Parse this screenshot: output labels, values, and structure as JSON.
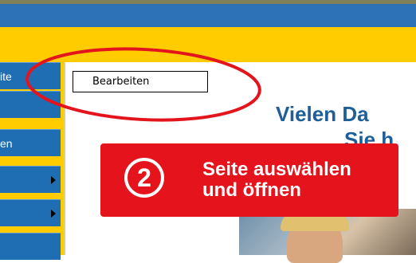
{
  "colors": {
    "topBar": "#2d72b7",
    "yellowBand": "#ffcc00",
    "nav": "#1f6db3",
    "heading": "#1f5f99",
    "callout": "#e5131b",
    "annotation": "#e3141c"
  },
  "sidebar": {
    "items": [
      {
        "label": "ite",
        "has_submenu": false
      },
      {
        "label": "",
        "has_submenu": false
      },
      {
        "label": "en",
        "has_submenu": false
      },
      {
        "label": "",
        "has_submenu": true
      },
      {
        "label": "",
        "has_submenu": true
      },
      {
        "label": "",
        "has_submenu": false
      }
    ]
  },
  "toolbar": {
    "edit_label": "Bearbeiten"
  },
  "main": {
    "heading_line1": "Vielen Da",
    "heading_line2": "Sie h"
  },
  "callout": {
    "step_number": "2",
    "line1": "Seite auswählen",
    "line2": "und öffnen"
  }
}
